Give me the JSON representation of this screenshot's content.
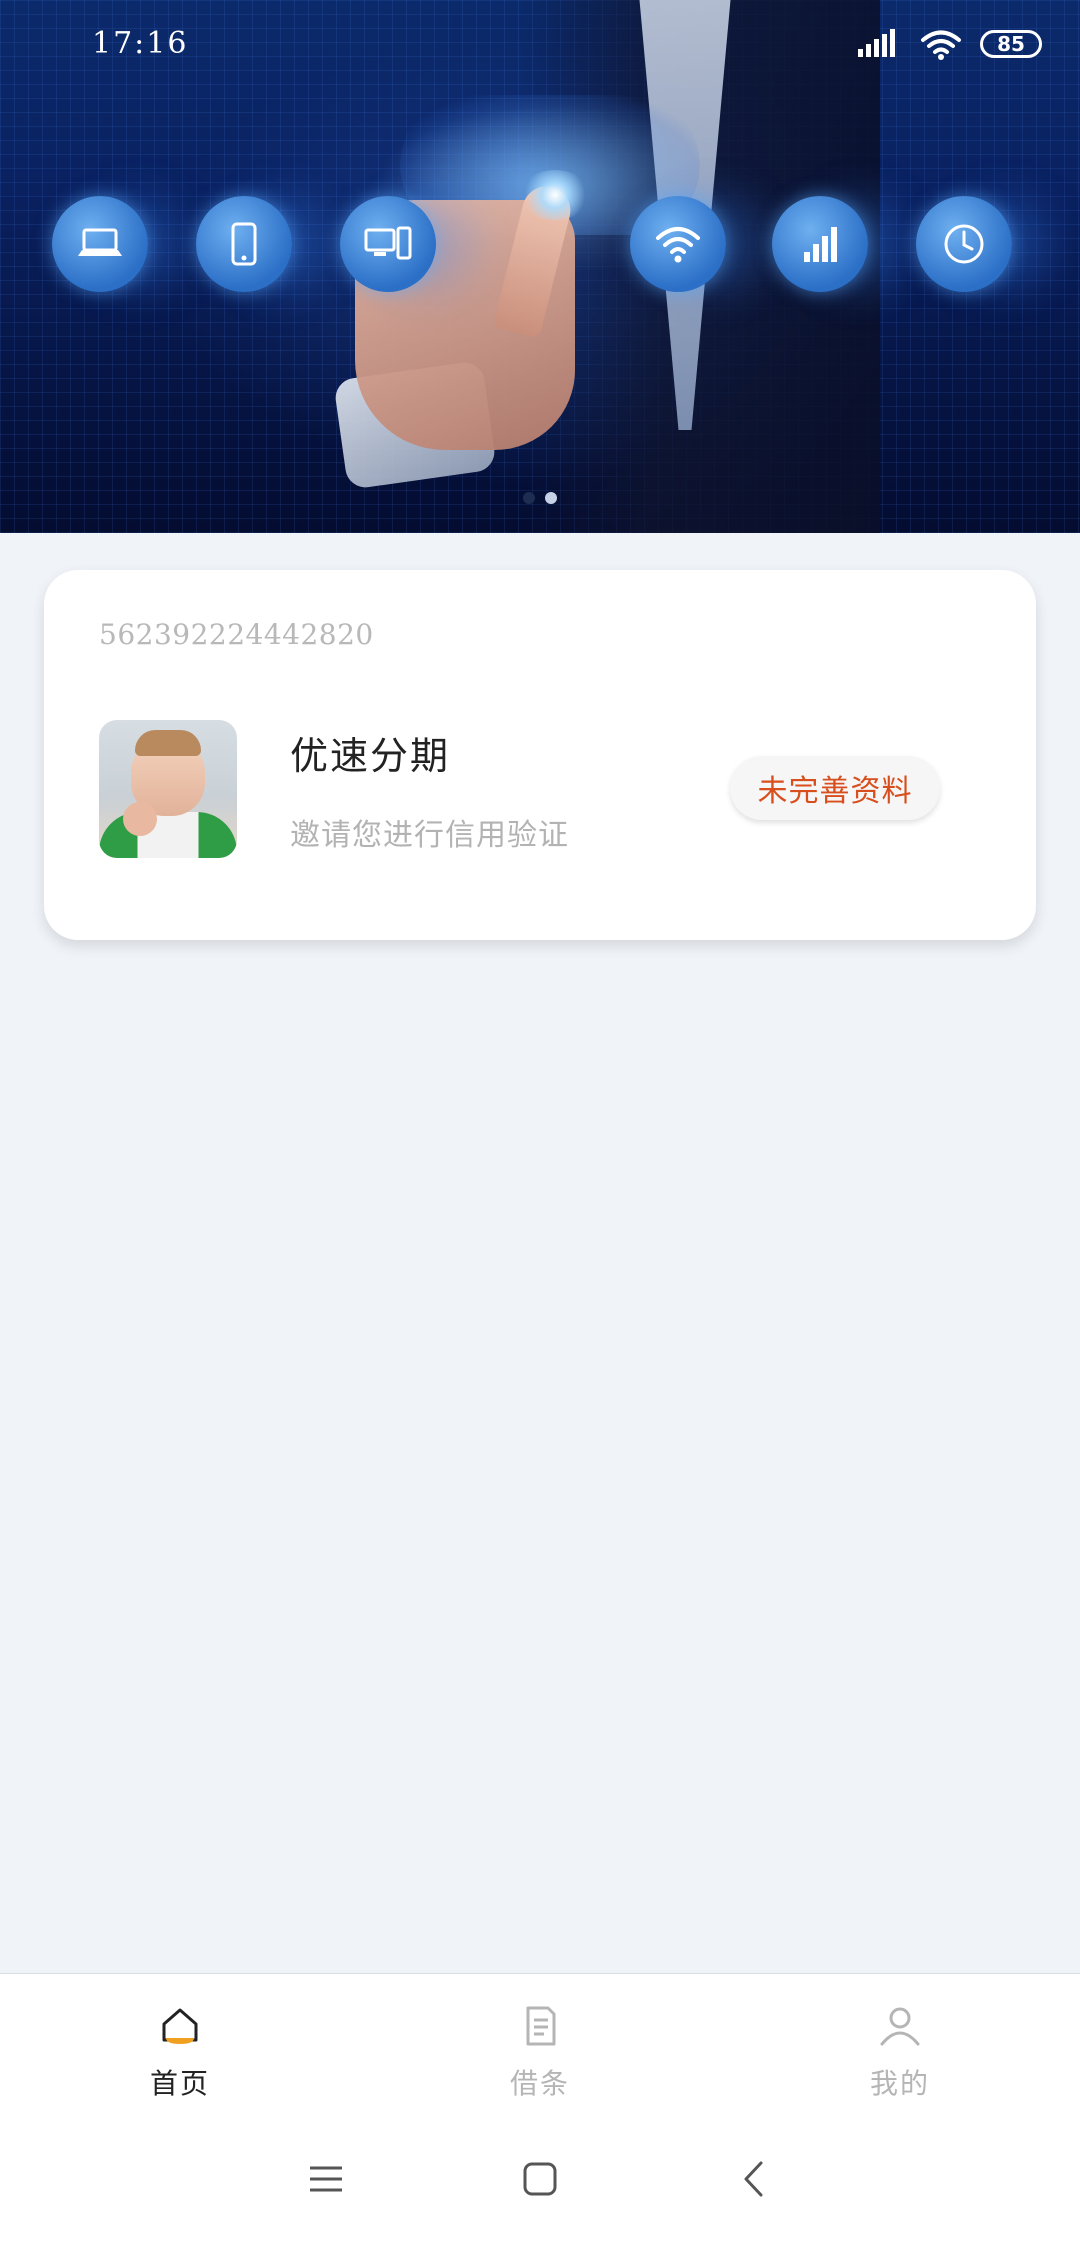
{
  "status_bar": {
    "time": "17:16",
    "battery": "85"
  },
  "banner": {
    "slide_count": 2,
    "active_slide": 2
  },
  "card": {
    "id_number": "562392224442820",
    "title": "优速分期",
    "subtitle": "邀请您进行信用验证",
    "action_label": "未完善资料",
    "accent_color": "#d94e1d"
  },
  "tabbar": {
    "tabs": [
      {
        "label": "首页",
        "icon": "home-icon",
        "active": true
      },
      {
        "label": "借条",
        "icon": "document-icon",
        "active": false
      },
      {
        "label": "我的",
        "icon": "user-icon",
        "active": false
      }
    ],
    "active_color": "#222222",
    "inactive_color": "#b5b5b5"
  },
  "system_nav": {
    "buttons": [
      "menu-icon",
      "home-square-icon",
      "back-icon"
    ]
  }
}
